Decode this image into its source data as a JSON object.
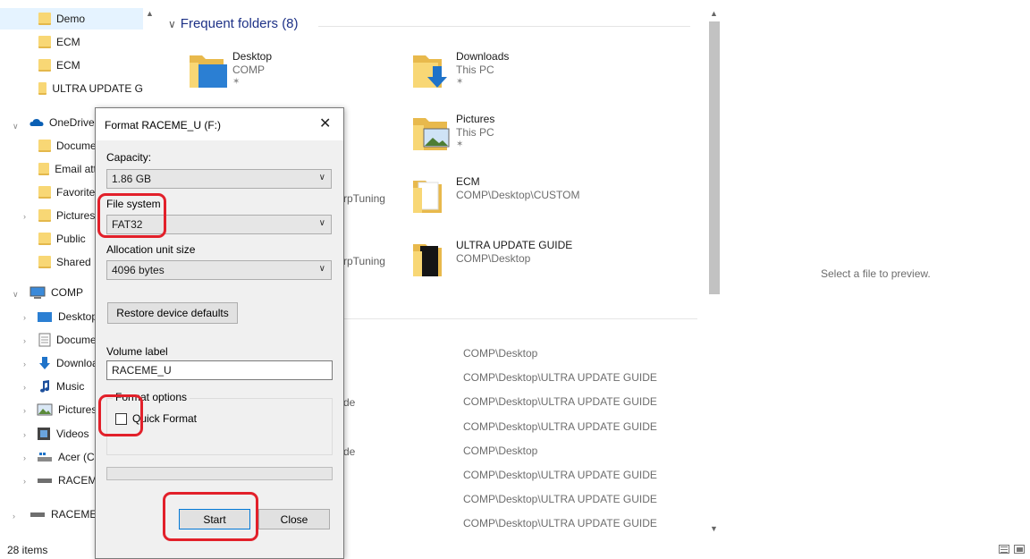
{
  "nav": {
    "items": [
      {
        "label": "Demo"
      },
      {
        "label": "ECM"
      },
      {
        "label": "ECM"
      },
      {
        "label": "ULTRA UPDATE G"
      },
      {
        "label": "OneDrive"
      },
      {
        "label": "Documents"
      },
      {
        "label": "Email attachments"
      },
      {
        "label": "Favorites"
      },
      {
        "label": "Pictures"
      },
      {
        "label": "Public"
      },
      {
        "label": "Shared"
      },
      {
        "label": "COMP"
      },
      {
        "label": "Desktop"
      },
      {
        "label": "Documents"
      },
      {
        "label": "Downloads"
      },
      {
        "label": "Music"
      },
      {
        "label": "Pictures"
      },
      {
        "label": "Videos"
      },
      {
        "label": "Acer (C:)"
      },
      {
        "label": "RACEME_U (F:)"
      },
      {
        "label": "RACEME_U (F:)"
      }
    ]
  },
  "content": {
    "group_title": "Frequent folders (8)",
    "frequent": [
      {
        "name": "Desktop",
        "location": "COMP",
        "pin": "✶"
      },
      {
        "name": "Downloads",
        "location": "This PC",
        "pin": "✶"
      },
      {
        "name": "Pictures",
        "location": "This PC",
        "pin": "✶"
      },
      {
        "name": "ECM",
        "location": "COMP\\Desktop\\CUSTOM"
      },
      {
        "name": "ULTRA UPDATE GUIDE",
        "location": "COMP\\Desktop"
      }
    ],
    "fragments": [
      "rpTuning",
      "rpTuning",
      "de",
      "de"
    ],
    "recent_paths": [
      "COMP\\Desktop",
      "COMP\\Desktop\\ULTRA UPDATE GUIDE",
      "COMP\\Desktop\\ULTRA UPDATE GUIDE",
      "COMP\\Desktop\\ULTRA UPDATE GUIDE",
      "COMP\\Desktop",
      "COMP\\Desktop\\ULTRA UPDATE GUIDE",
      "COMP\\Desktop\\ULTRA UPDATE GUIDE",
      "COMP\\Desktop\\ULTRA UPDATE GUIDE"
    ]
  },
  "preview": {
    "text": "Select a file to preview."
  },
  "status": {
    "item_count": "28 items"
  },
  "dialog": {
    "title": "Format RACEME_U (F:)",
    "capacity_label": "Capacity:",
    "capacity_value": "1.86 GB",
    "filesystem_label": "File system",
    "filesystem_value": "FAT32",
    "allocation_label": "Allocation unit size",
    "allocation_value": "4096 bytes",
    "restore_button": "Restore device defaults",
    "volume_label": "Volume label",
    "volume_value": "RACEME_U",
    "format_options_label": "Format options",
    "quick_format_label": "Quick Format",
    "quick_format_checked": false,
    "progress_fraction": 0,
    "start_button": "Start",
    "close_button": "Close"
  },
  "colors": {
    "annotation_red": "#e2202a",
    "folder_yellow": "#f8d775",
    "selection_blue": "#e5f3ff",
    "accent_blue": "#0078d7"
  }
}
